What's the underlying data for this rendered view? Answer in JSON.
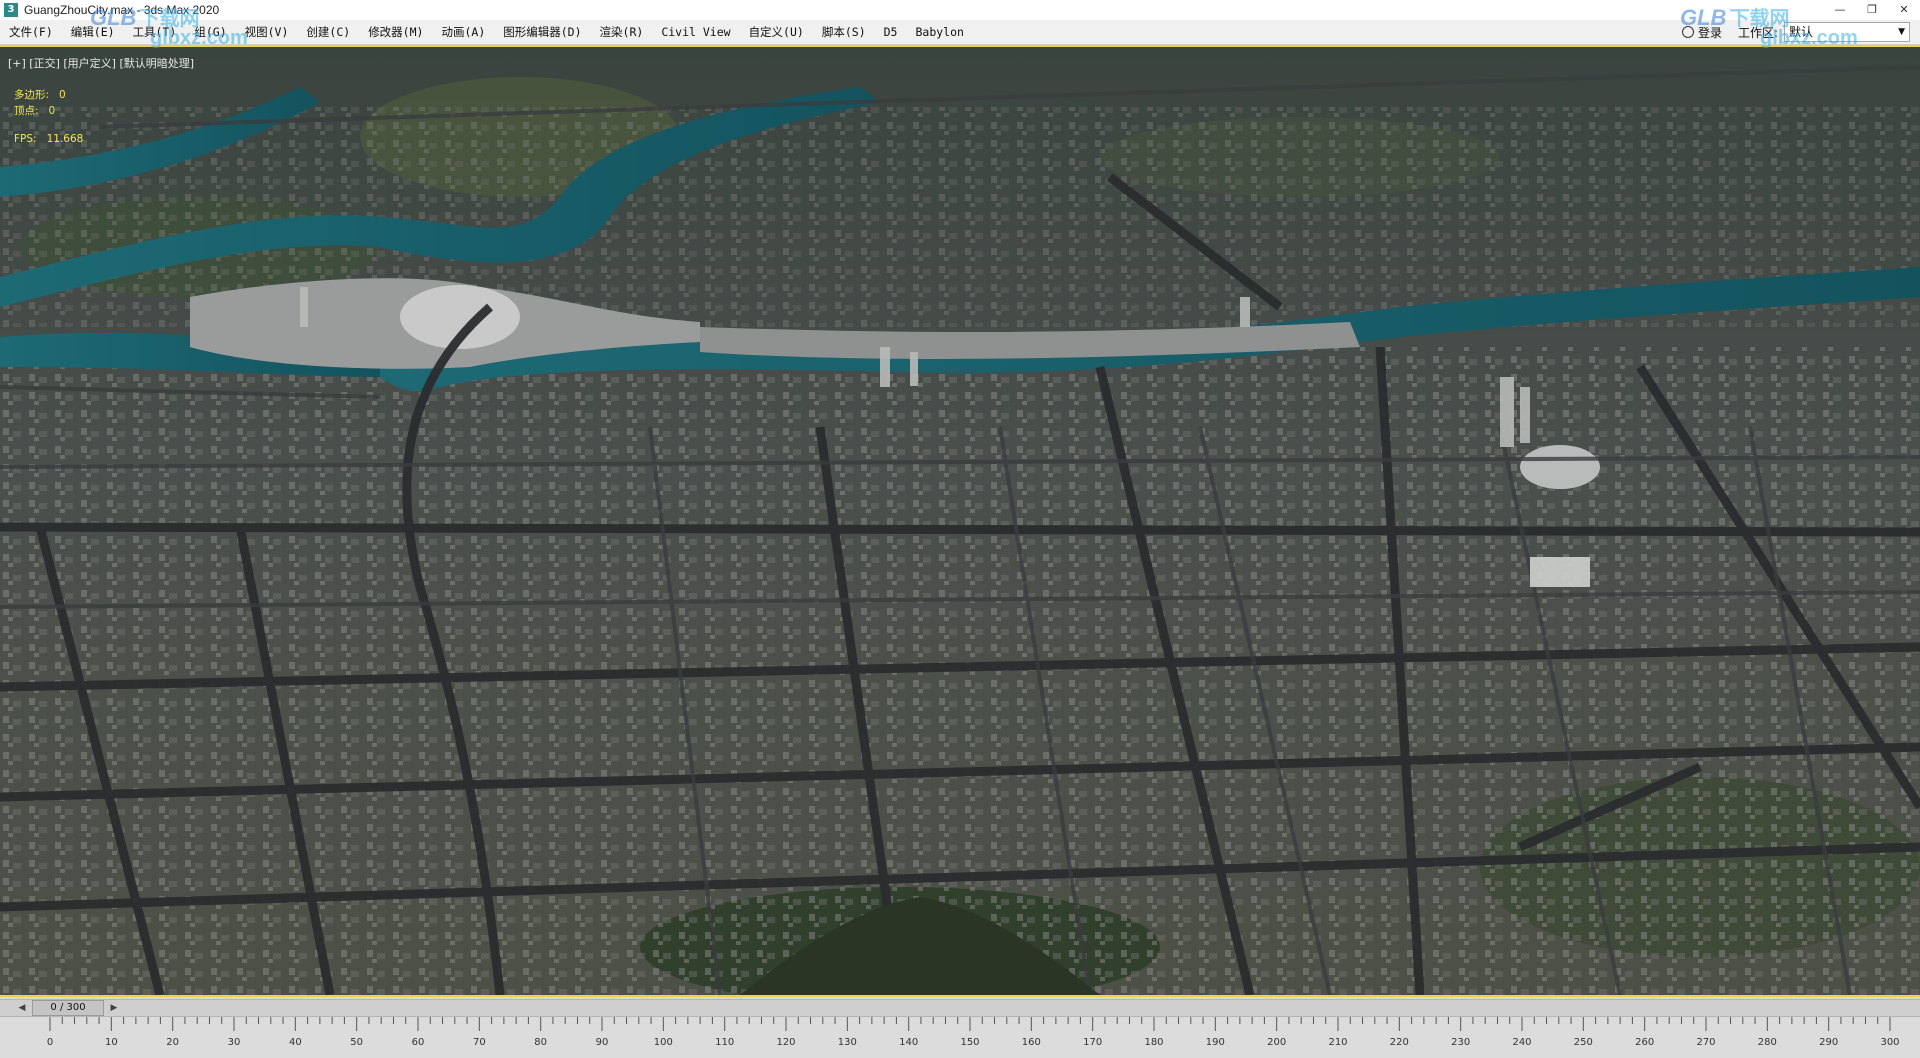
{
  "window": {
    "title": "GuangZhouCity.max - 3ds Max 2020",
    "icon": "3dsmax-app-icon",
    "controls": [
      "minimize",
      "restore",
      "close"
    ]
  },
  "menubar": {
    "items": [
      "文件(F)",
      "编辑(E)",
      "工具(T)",
      "组(G)",
      "视图(V)",
      "创建(C)",
      "修改器(M)",
      "动画(A)",
      "图形编辑器(D)",
      "渲染(R)",
      "Civil View",
      "自定义(U)",
      "脚本(S)",
      "D5",
      "Babylon"
    ],
    "signin_label": "登录",
    "signin_icon": "user-icon",
    "workspace_label": "工作区:",
    "workspace_value": "默认"
  },
  "viewport": {
    "label": "[+] [正交] [用户定义] [默认明暗处理]",
    "stats": {
      "polygons_label": "多边形:",
      "polygons_value": "0",
      "vertices_label": "顶点:",
      "vertices_value": "0",
      "fps_label": "FPS:",
      "fps_value": "11.668"
    },
    "border_color": "#e8d34a",
    "scene": "aerial-city-model"
  },
  "watermark": {
    "brand": "GLB",
    "cn": "下载网",
    "url": "glbxz.com"
  },
  "timeline": {
    "frame_display": "0 / 300",
    "ticks": [
      "0",
      "10",
      "20",
      "30",
      "40",
      "50",
      "60",
      "70",
      "80",
      "90",
      "100",
      "110",
      "120",
      "130",
      "140",
      "150",
      "160",
      "170",
      "180",
      "190",
      "200",
      "210",
      "220",
      "230",
      "240",
      "250",
      "260",
      "270",
      "280",
      "290",
      "300"
    ]
  }
}
